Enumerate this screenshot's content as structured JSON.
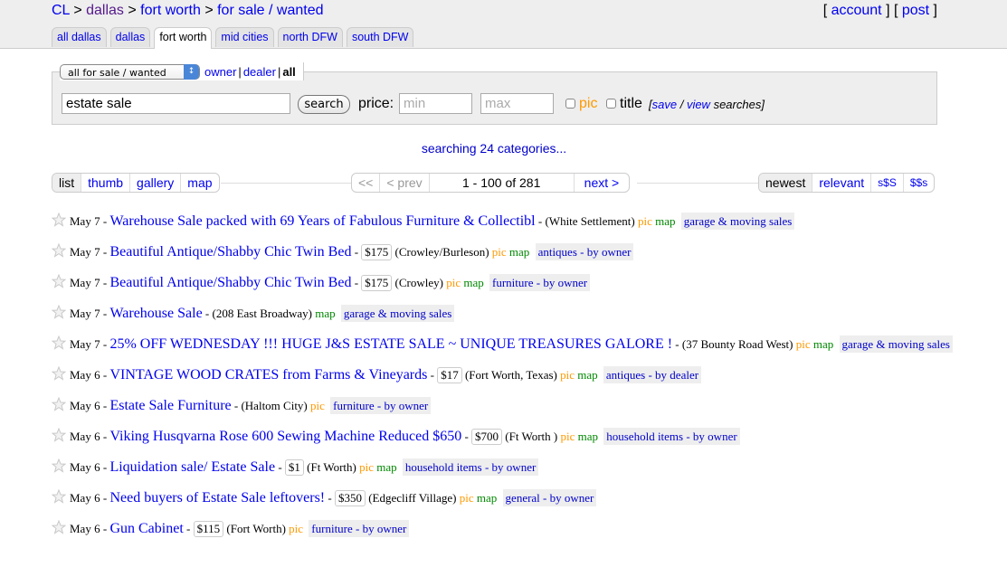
{
  "header": {
    "breadcrumb": [
      {
        "label": "CL",
        "visited": false
      },
      {
        "label": "dallas",
        "visited": true
      },
      {
        "label": "fort worth",
        "visited": false
      },
      {
        "label": "for sale / wanted",
        "visited": false
      }
    ],
    "breadcrumb_sep": ">",
    "account_label": "account",
    "post_label": "post",
    "tabs": [
      {
        "label": "all dallas",
        "active": false
      },
      {
        "label": "dallas",
        "active": false
      },
      {
        "label": "fort worth",
        "active": true
      },
      {
        "label": "mid cities",
        "active": false
      },
      {
        "label": "north DFW",
        "active": false
      },
      {
        "label": "south DFW",
        "active": false
      }
    ]
  },
  "search": {
    "category_select": "all for sale / wanted",
    "filter_owner": "owner",
    "filter_dealer": "dealer",
    "filter_all": "all",
    "query": "estate sale",
    "search_button": "search",
    "price_label": "price:",
    "min_placeholder": "min",
    "max_placeholder": "max",
    "pic_label": "pic",
    "title_label": "title",
    "save_label": "save",
    "view_label": "view",
    "searches_label": "searches]",
    "bracket_open": "[",
    "slash": " / "
  },
  "status": "searching 24 categories...",
  "view_modes": [
    {
      "label": "list",
      "selected": true
    },
    {
      "label": "thumb",
      "selected": false
    },
    {
      "label": "gallery",
      "selected": false
    },
    {
      "label": "map",
      "selected": false
    }
  ],
  "pagination": {
    "first": "<<",
    "prev": "< prev",
    "range": "1 - 100 of 281",
    "next": "next >"
  },
  "sort": [
    {
      "label": "newest",
      "selected": true
    },
    {
      "label": "relevant",
      "selected": false
    },
    {
      "label": "s$S",
      "selected": false
    },
    {
      "label": "$$s",
      "selected": false
    }
  ],
  "listings": [
    {
      "date": "May 7",
      "title": "Warehouse Sale packed with 69 Years of Fabulous Furniture & Collectibl",
      "price": "",
      "location": "(White Settlement)",
      "pic": true,
      "map": true,
      "category": "garage & moving sales"
    },
    {
      "date": "May 7",
      "title": "Beautiful Antique/Shabby Chic Twin Bed",
      "price": "$175",
      "location": "(Crowley/Burleson)",
      "pic": true,
      "map": true,
      "category": "antiques - by owner"
    },
    {
      "date": "May 7",
      "title": "Beautiful Antique/Shabby Chic Twin Bed",
      "price": "$175",
      "location": "(Crowley)",
      "pic": true,
      "map": true,
      "category": "furniture - by owner"
    },
    {
      "date": "May 7",
      "title": "Warehouse Sale",
      "price": "",
      "location": "(208 East Broadway)",
      "pic": false,
      "map": true,
      "category": "garage & moving sales"
    },
    {
      "date": "May 7",
      "title": "25% OFF WEDNESDAY !!! HUGE J&S ESTATE SALE ~ UNIQUE TREASURES GALORE !",
      "price": "",
      "location": "(37 Bounty Road West)",
      "pic": true,
      "map": true,
      "category": "garage & moving sales"
    },
    {
      "date": "May 6",
      "title": "VINTAGE WOOD CRATES from Farms & Vineyards",
      "price": "$17",
      "location": "(Fort Worth, Texas)",
      "pic": true,
      "map": true,
      "category": "antiques - by dealer"
    },
    {
      "date": "May 6",
      "title": "Estate Sale Furniture",
      "price": "",
      "location": "(Haltom City)",
      "pic": true,
      "map": false,
      "category": "furniture - by owner"
    },
    {
      "date": "May 6",
      "title": "Viking Husqvarna Rose 600 Sewing Machine Reduced $650",
      "price": "$700",
      "location": "(Ft Worth )",
      "pic": true,
      "map": true,
      "category": "household items - by owner"
    },
    {
      "date": "May 6",
      "title": "Liquidation sale/ Estate Sale",
      "price": "$1",
      "location": "(Ft Worth)",
      "pic": true,
      "map": true,
      "category": "household items - by owner"
    },
    {
      "date": "May 6",
      "title": "Need buyers of Estate Sale leftovers!",
      "price": "$350",
      "location": "(Edgecliff Village)",
      "pic": true,
      "map": true,
      "category": "general - by owner"
    },
    {
      "date": "May 6",
      "title": "Gun Cabinet",
      "price": "$115",
      "location": "(Fort Worth)",
      "pic": true,
      "map": false,
      "category": "furniture - by owner"
    }
  ],
  "labels": {
    "pic": "pic",
    "map": "map",
    "dash": " - "
  },
  "colors": {
    "link": "#0000ee",
    "pic": "#ff9900",
    "map": "#008800",
    "panel": "#eeeeee"
  }
}
